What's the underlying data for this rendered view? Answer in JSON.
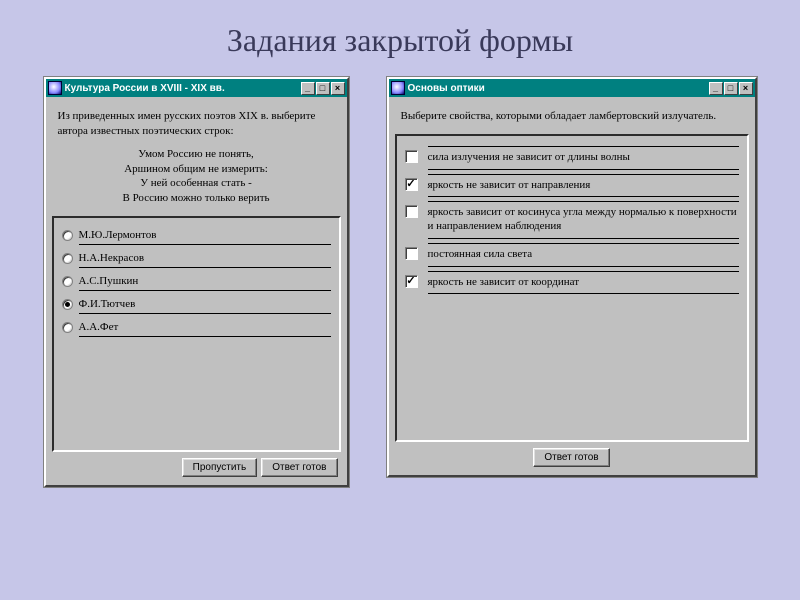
{
  "slide_title": "Задания закрытой формы",
  "window_left": {
    "title": "Культура России в XVIII - XIX вв.",
    "question_intro": "Из приведенных имен русских поэтов XIX в. выберите автора известных поэтических строк:",
    "poem": [
      "Умом Россию не понять,",
      "Аршином общим не измерить:",
      "У ней особенная стать -",
      "В Россию можно только верить"
    ],
    "options": [
      {
        "label": "М.Ю.Лермонтов",
        "selected": false
      },
      {
        "label": "Н.А.Некрасов",
        "selected": false
      },
      {
        "label": "А.С.Пушкин",
        "selected": false
      },
      {
        "label": "Ф.И.Тютчев",
        "selected": true
      },
      {
        "label": "А.А.Фет",
        "selected": false
      }
    ],
    "buttons": {
      "skip": "Пропустить",
      "submit": "Ответ готов"
    }
  },
  "window_right": {
    "title": "Основы оптики",
    "question": "Выберите свойства, которыми обладает ламбертовский излучатель.",
    "options": [
      {
        "label": "сила излучения не зависит от длины волны",
        "checked": false
      },
      {
        "label": "яркость не зависит от направления",
        "checked": true
      },
      {
        "label": "яркость зависит от косинуса угла между нормалью к поверхности и направлением наблюдения",
        "checked": false
      },
      {
        "label": "постоянная сила света",
        "checked": false
      },
      {
        "label": "яркость не зависит от координат",
        "checked": true
      }
    ],
    "buttons": {
      "submit": "Ответ готов"
    }
  },
  "win_controls": {
    "min": "_",
    "max": "□",
    "close": "×"
  }
}
